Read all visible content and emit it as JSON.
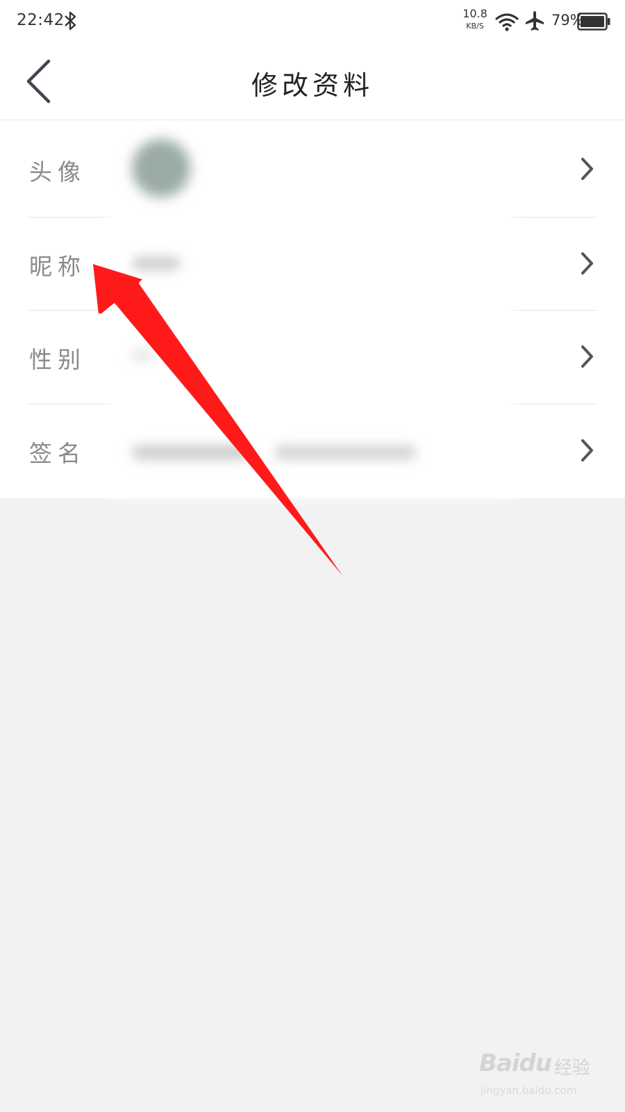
{
  "status_bar": {
    "time": "22:42",
    "net_speed_value": "10.8",
    "net_speed_unit": "KB/S",
    "battery_percent": "79%",
    "icons": [
      "bluetooth-icon",
      "wifi-icon",
      "airplane-icon",
      "battery-icon"
    ]
  },
  "header": {
    "title": "修改资料",
    "back_icon": "chevron-left-icon"
  },
  "profile_rows": [
    {
      "label": "头像",
      "value": ""
    },
    {
      "label": "昵称",
      "value": ""
    },
    {
      "label": "性别",
      "value": ""
    },
    {
      "label": "签名",
      "value": ""
    }
  ],
  "annotation": {
    "color": "#ff1a1a",
    "points_to": "昵称"
  },
  "watermark": {
    "logo": "Baidu",
    "text": "经验",
    "url": "jingyan.baidu.com"
  },
  "colors": {
    "background": "#f2f2f2",
    "surface": "#ffffff",
    "label": "#8a8a8a",
    "title": "#222222"
  }
}
